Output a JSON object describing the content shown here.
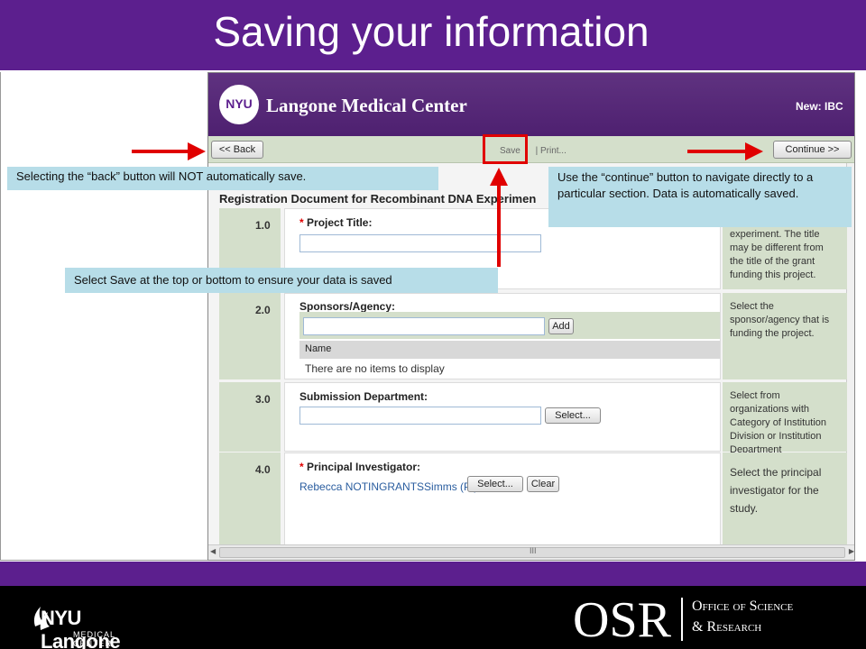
{
  "slide": {
    "title": "Saving your information",
    "footer": {
      "logo_line1": "NYU Langone",
      "logo_line2": "MEDICAL CENTER",
      "osr": "OSR",
      "office_line1": "Office of Science",
      "office_line2": "& Research"
    }
  },
  "app": {
    "logo_text": "NYU",
    "brand": "Langone Medical Center",
    "mode": "New: IBC",
    "toolbar": {
      "back_label": "<< Back",
      "save_label": "Save",
      "separator": "|",
      "print_label": "Print...",
      "continue_label": "Continue >>"
    },
    "document_title": "Registration Document for Recombinant DNA Experimen",
    "sections": [
      {
        "number": "1.0",
        "required_mark": "*",
        "label": "Project Title:",
        "input_value": "",
        "help": "experiment. The title may be different from the title of the grant funding this project."
      },
      {
        "number": "2.0",
        "label": "Sponsors/Agency:",
        "input_value": "",
        "button": "Add",
        "grid_header": "Name",
        "grid_empty": "There are no items to display",
        "help": "Select the sponsor/agency that is funding the project."
      },
      {
        "number": "3.0",
        "label": "Submission Department:",
        "input_value": "",
        "button": "Select...",
        "help": "Select from organizations with Category of Institution Division or Institution Department"
      },
      {
        "number": "4.0",
        "required_mark": "*",
        "label": "Principal Investigator:",
        "value": "Rebecca NOTINGRANTSSimms (PI)",
        "select_button": "Select...",
        "clear_button": "Clear",
        "help": "Select the principal investigator for the study."
      }
    ],
    "scrollbar_grip": "III"
  },
  "callouts": {
    "back": "Selecting the “back” button will NOT automatically save.",
    "continue": "Use the “continue” button to navigate directly to a particular section.  Data is automatically saved.",
    "save": "Select Save at the top or bottom to ensure your data is saved"
  },
  "colors": {
    "purple": "#5c1f8e",
    "callout": "#b7dde8",
    "arrow_red": "#e00000",
    "panel_green": "#d4dfcb"
  }
}
